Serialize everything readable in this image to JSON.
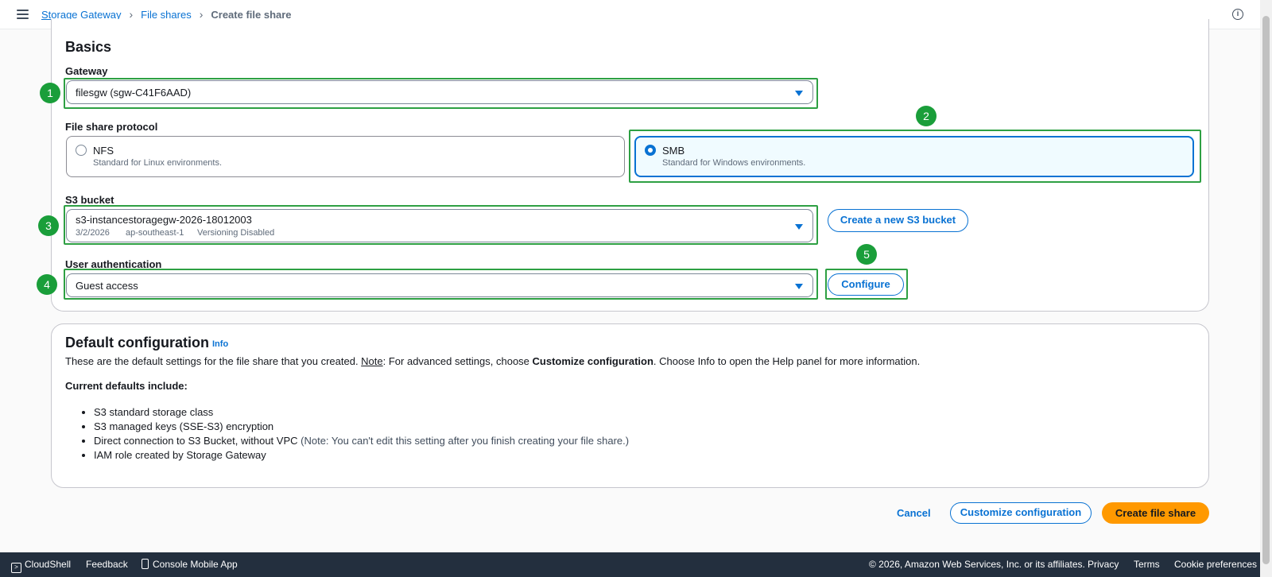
{
  "breadcrumb": {
    "items": [
      "Storage Gateway",
      "File shares"
    ],
    "current": "Create file share"
  },
  "basics": {
    "title": "Basics",
    "gateway": {
      "label": "Gateway",
      "value": "filesgw (sgw-C41F6AAD)"
    },
    "protocol": {
      "label": "File share protocol",
      "options": [
        {
          "title": "NFS",
          "desc": "Standard for Linux environments.",
          "selected": false
        },
        {
          "title": "SMB",
          "desc": "Standard for Windows environments.",
          "selected": true
        }
      ]
    },
    "s3": {
      "label": "S3 bucket",
      "value": "s3-instancestoragegw-2026-18012003",
      "date": "3/2/2026",
      "region": "ap-southeast-1",
      "versioning": "Versioning Disabled",
      "create_button": "Create a new S3 bucket"
    },
    "auth": {
      "label": "User authentication",
      "value": "Guest access",
      "configure_button": "Configure"
    }
  },
  "callouts": [
    "1",
    "2",
    "3",
    "4",
    "5"
  ],
  "default_config": {
    "title": "Default configuration",
    "info": "Info",
    "desc_pre": "These are the default settings for the file share that you created. ",
    "desc_note": "Note",
    "desc_mid": ": For advanced settings, choose ",
    "desc_bold": "Customize configuration",
    "desc_post": ". Choose Info to open the Help panel for more information.",
    "current_label": "Current defaults include:",
    "items": [
      "S3 standard storage class",
      "S3 managed keys (SSE-S3) encryption",
      "Direct connection to S3 Bucket, without VPC",
      "IAM role created by Storage Gateway"
    ],
    "item3_note": "(Note: You can't edit this setting after you finish creating your file share.)"
  },
  "actions": {
    "cancel": "Cancel",
    "customize": "Customize configuration",
    "create": "Create file share"
  },
  "footer": {
    "cloudshell": "CloudShell",
    "feedback": "Feedback",
    "mobile": "Console Mobile App",
    "copyright": "© 2026, Amazon Web Services, Inc. or its affiliates.",
    "privacy": "Privacy",
    "terms": "Terms",
    "cookies": "Cookie preferences"
  },
  "colors": {
    "accent": "#0972d3",
    "highlight": "#2ea043",
    "primary_button": "#ff9900",
    "footer_bg": "#232f3e"
  }
}
